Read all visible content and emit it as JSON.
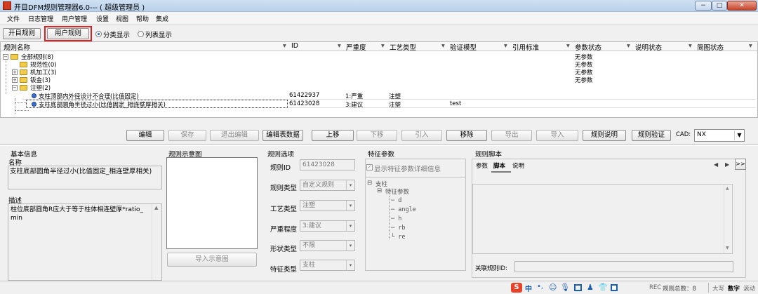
{
  "window": {
    "title": "开目DFM规则管理器6.0--- ( 超级管理员 )",
    "controls": {
      "minimize": "−",
      "maximize": "□",
      "close": "✕"
    }
  },
  "menu": [
    "文件",
    "日志管理",
    "用户管理",
    "设置",
    "视图",
    "帮助",
    "集成"
  ],
  "top_buttons": {
    "open_rules": "开目规则",
    "user_rules": "用户规则"
  },
  "view_mode": {
    "classified": "分类显示",
    "list": "列表显示"
  },
  "grid": {
    "headers": [
      "规则名称",
      "ID",
      "严重度",
      "工艺类型",
      "验证模型",
      "引用标准",
      "参数状态",
      "说明状态",
      "简图状态"
    ],
    "tree": [
      {
        "label": "全部规则(8)",
        "param_status": "无参数"
      },
      {
        "label": "规范性(0)",
        "param_status": "无参数"
      },
      {
        "label": "机加工(3)",
        "param_status": "无参数"
      },
      {
        "label": "钣金(3)",
        "param_status": "无参数"
      },
      {
        "label": "注塑(2)",
        "param_status": ""
      }
    ],
    "rows": [
      {
        "name": "支柱顶部内外径设计不合理(比值固定)",
        "id": "61422937",
        "severity": "1:严重",
        "process": "注塑",
        "model": ""
      },
      {
        "name": "支柱底部圆角半径过小(比值固定_相连壁厚相关)",
        "id": "61423028",
        "severity": "3:建议",
        "process": "注塑",
        "model": "test"
      }
    ]
  },
  "action_buttons": [
    "编辑",
    "保存",
    "退出编辑",
    "编辑表数据",
    "上移",
    "下移",
    "引入",
    "移除",
    "导出",
    "导入",
    "规则说明",
    "规则验证"
  ],
  "cad": {
    "label": "CAD:",
    "value": "NX"
  },
  "basic_info": {
    "title": "基本信息",
    "name_label": "名称",
    "name_value": "支柱底部圆角半径过小(比值固定_相连壁厚相关)",
    "desc_label": "描述",
    "desc_value": "柱位底部圆角R应大于等于柱体相连壁厚*ratio_min"
  },
  "diagram": {
    "title": "规则示意图",
    "import_button": "导入示意图"
  },
  "options": {
    "title": "规则选项",
    "rule_id_label": "规则ID",
    "rule_id_value": "61423028",
    "rule_type_label": "规则类型",
    "rule_type_value": "自定义规则",
    "process_label": "工艺类型",
    "process_value": "注塑",
    "severity_label": "严重程度",
    "severity_value": "3:建议",
    "shape_label": "形状类型",
    "shape_value": "不限",
    "feature_label": "特征类型",
    "feature_value": "支柱"
  },
  "feature_params": {
    "title": "特征参数",
    "checkbox_label": "显示特征参数详细信息",
    "root": "支柱",
    "group": "特征参数",
    "params": [
      "d",
      "angle",
      "h",
      "rb",
      "re"
    ]
  },
  "script": {
    "title": "规则脚本",
    "tabs": [
      "参数",
      "脚本",
      "说明"
    ],
    "related_label": "关联规则ID:"
  },
  "status": {
    "rec": "REC",
    "total": "规则总数：8",
    "caps": "大写",
    "num": "数字",
    "scroll": "滚动"
  },
  "colors": {
    "highlight_border": "#e02020",
    "tray_logo": "#e8432a"
  }
}
